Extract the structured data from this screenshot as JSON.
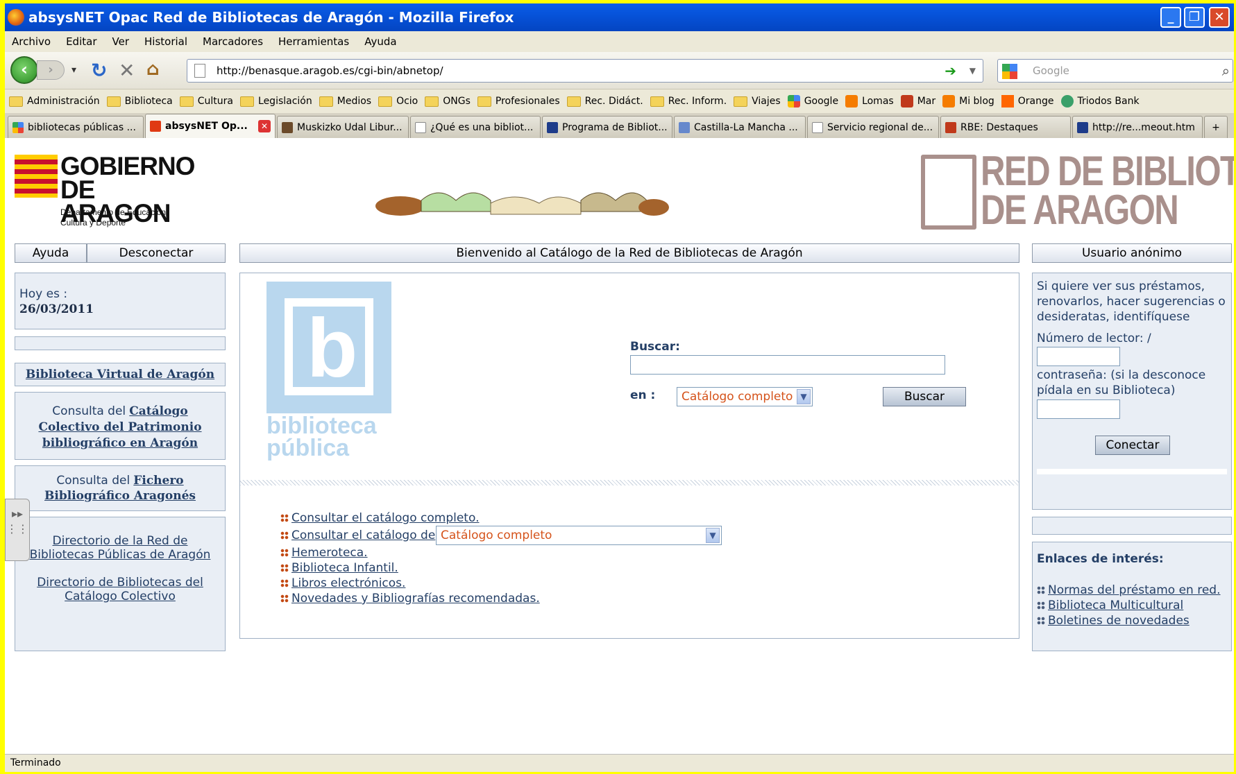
{
  "window": {
    "title": "absysNET Opac Red de Bibliotecas de Aragón - Mozilla Firefox"
  },
  "menu": [
    "Archivo",
    "Editar",
    "Ver",
    "Historial",
    "Marcadores",
    "Herramientas",
    "Ayuda"
  ],
  "nav": {
    "url": "http://benasque.aragob.es/cgi-bin/abnetop/",
    "search_placeholder": "Google"
  },
  "bookmarks": [
    "Administración",
    "Biblioteca",
    "Cultura",
    "Legislación",
    "Medios",
    "Ocio",
    "ONGs",
    "Profesionales",
    "Rec. Didáct.",
    "Rec. Inform.",
    "Viajes",
    "Google",
    "Lomas",
    "Mar",
    "Mi blog",
    "Orange",
    "Triodos Bank"
  ],
  "tabs": [
    "bibliotecas públicas ...",
    "absysNET Op...",
    "Muskizko Udal Libur...",
    "¿Qué es una bibliot...",
    "Programa de Bibliot...",
    "Castilla-La Mancha ...",
    "Servicio regional de...",
    "RBE: Destaques",
    "http://re...meout.htm"
  ],
  "status": "Terminado",
  "page": {
    "gob_line1": "GOBIERNO",
    "gob_line2": "DE ARAGON",
    "gob_sub1": "Departamento de Educación,",
    "gob_sub2": "Cultura y Deporte",
    "red_line1": "RED DE BIBLIOTECAS",
    "red_line2": "DE ARAGON",
    "btn_ayuda": "Ayuda",
    "btn_desconectar": "Desconectar",
    "welcome": "Bienvenido al Catálogo de la Red de Bibliotecas de Aragón",
    "usuario": "Usuario anónimo",
    "hoy_label": "Hoy es :",
    "hoy_date": "26/03/2011",
    "biblioteca_virtual": "Biblioteca Virtual de Aragón",
    "consulta_del": "Consulta del",
    "catalogo_colectivo": "Catálogo Colectivo del Patrimonio bibliográfico en Aragón",
    "fichero": "Fichero Bibliográfico Aragonés",
    "directorio_red": "Directorio de la Red de Bibliotecas Públicas de Aragón",
    "directorio_cat": "Directorio de Bibliotecas del Catálogo Colectivo",
    "logo_line1": "biblioteca",
    "logo_line2": "pública",
    "buscar_label": "Buscar:",
    "en_label": "en :",
    "select_value": "Catálogo completo",
    "buscar_btn": "Buscar",
    "links": [
      "Consultar el catálogo completo.",
      "Consultar el catálogo de",
      "Hemeroteca.",
      "Biblioteca Infantil.",
      "Libros electrónicos.",
      "Novedades y Bibliografías recomendadas."
    ],
    "login_text": "Si quiere ver sus préstamos, renovarlos, hacer sugerencias o desideratas, identifíquese",
    "lector_label": "Número de lector: /",
    "password_label": "contraseña: (si la desconoce pídala en su Biblioteca)",
    "conectar_btn": "Conectar",
    "enlaces_title": "Enlaces de interés:",
    "enlaces": [
      "Normas del préstamo en red.",
      "Biblioteca Multicultural",
      "Boletines de novedades"
    ]
  }
}
